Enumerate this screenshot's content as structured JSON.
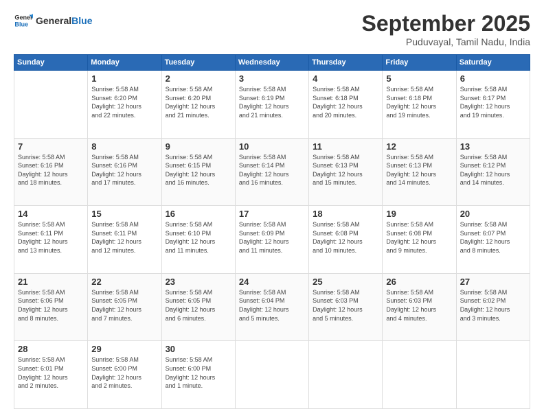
{
  "header": {
    "logo_line1": "General",
    "logo_line2": "Blue",
    "month_title": "September 2025",
    "location": "Puduvayal, Tamil Nadu, India"
  },
  "columns": [
    "Sunday",
    "Monday",
    "Tuesday",
    "Wednesday",
    "Thursday",
    "Friday",
    "Saturday"
  ],
  "weeks": [
    [
      {
        "day": "",
        "info": ""
      },
      {
        "day": "1",
        "info": "Sunrise: 5:58 AM\nSunset: 6:20 PM\nDaylight: 12 hours\nand 22 minutes."
      },
      {
        "day": "2",
        "info": "Sunrise: 5:58 AM\nSunset: 6:20 PM\nDaylight: 12 hours\nand 21 minutes."
      },
      {
        "day": "3",
        "info": "Sunrise: 5:58 AM\nSunset: 6:19 PM\nDaylight: 12 hours\nand 21 minutes."
      },
      {
        "day": "4",
        "info": "Sunrise: 5:58 AM\nSunset: 6:18 PM\nDaylight: 12 hours\nand 20 minutes."
      },
      {
        "day": "5",
        "info": "Sunrise: 5:58 AM\nSunset: 6:18 PM\nDaylight: 12 hours\nand 19 minutes."
      },
      {
        "day": "6",
        "info": "Sunrise: 5:58 AM\nSunset: 6:17 PM\nDaylight: 12 hours\nand 19 minutes."
      }
    ],
    [
      {
        "day": "7",
        "info": "Sunrise: 5:58 AM\nSunset: 6:16 PM\nDaylight: 12 hours\nand 18 minutes."
      },
      {
        "day": "8",
        "info": "Sunrise: 5:58 AM\nSunset: 6:16 PM\nDaylight: 12 hours\nand 17 minutes."
      },
      {
        "day": "9",
        "info": "Sunrise: 5:58 AM\nSunset: 6:15 PM\nDaylight: 12 hours\nand 16 minutes."
      },
      {
        "day": "10",
        "info": "Sunrise: 5:58 AM\nSunset: 6:14 PM\nDaylight: 12 hours\nand 16 minutes."
      },
      {
        "day": "11",
        "info": "Sunrise: 5:58 AM\nSunset: 6:13 PM\nDaylight: 12 hours\nand 15 minutes."
      },
      {
        "day": "12",
        "info": "Sunrise: 5:58 AM\nSunset: 6:13 PM\nDaylight: 12 hours\nand 14 minutes."
      },
      {
        "day": "13",
        "info": "Sunrise: 5:58 AM\nSunset: 6:12 PM\nDaylight: 12 hours\nand 14 minutes."
      }
    ],
    [
      {
        "day": "14",
        "info": "Sunrise: 5:58 AM\nSunset: 6:11 PM\nDaylight: 12 hours\nand 13 minutes."
      },
      {
        "day": "15",
        "info": "Sunrise: 5:58 AM\nSunset: 6:11 PM\nDaylight: 12 hours\nand 12 minutes."
      },
      {
        "day": "16",
        "info": "Sunrise: 5:58 AM\nSunset: 6:10 PM\nDaylight: 12 hours\nand 11 minutes."
      },
      {
        "day": "17",
        "info": "Sunrise: 5:58 AM\nSunset: 6:09 PM\nDaylight: 12 hours\nand 11 minutes."
      },
      {
        "day": "18",
        "info": "Sunrise: 5:58 AM\nSunset: 6:08 PM\nDaylight: 12 hours\nand 10 minutes."
      },
      {
        "day": "19",
        "info": "Sunrise: 5:58 AM\nSunset: 6:08 PM\nDaylight: 12 hours\nand 9 minutes."
      },
      {
        "day": "20",
        "info": "Sunrise: 5:58 AM\nSunset: 6:07 PM\nDaylight: 12 hours\nand 8 minutes."
      }
    ],
    [
      {
        "day": "21",
        "info": "Sunrise: 5:58 AM\nSunset: 6:06 PM\nDaylight: 12 hours\nand 8 minutes."
      },
      {
        "day": "22",
        "info": "Sunrise: 5:58 AM\nSunset: 6:05 PM\nDaylight: 12 hours\nand 7 minutes."
      },
      {
        "day": "23",
        "info": "Sunrise: 5:58 AM\nSunset: 6:05 PM\nDaylight: 12 hours\nand 6 minutes."
      },
      {
        "day": "24",
        "info": "Sunrise: 5:58 AM\nSunset: 6:04 PM\nDaylight: 12 hours\nand 5 minutes."
      },
      {
        "day": "25",
        "info": "Sunrise: 5:58 AM\nSunset: 6:03 PM\nDaylight: 12 hours\nand 5 minutes."
      },
      {
        "day": "26",
        "info": "Sunrise: 5:58 AM\nSunset: 6:03 PM\nDaylight: 12 hours\nand 4 minutes."
      },
      {
        "day": "27",
        "info": "Sunrise: 5:58 AM\nSunset: 6:02 PM\nDaylight: 12 hours\nand 3 minutes."
      }
    ],
    [
      {
        "day": "28",
        "info": "Sunrise: 5:58 AM\nSunset: 6:01 PM\nDaylight: 12 hours\nand 2 minutes."
      },
      {
        "day": "29",
        "info": "Sunrise: 5:58 AM\nSunset: 6:00 PM\nDaylight: 12 hours\nand 2 minutes."
      },
      {
        "day": "30",
        "info": "Sunrise: 5:58 AM\nSunset: 6:00 PM\nDaylight: 12 hours\nand 1 minute."
      },
      {
        "day": "",
        "info": ""
      },
      {
        "day": "",
        "info": ""
      },
      {
        "day": "",
        "info": ""
      },
      {
        "day": "",
        "info": ""
      }
    ]
  ]
}
